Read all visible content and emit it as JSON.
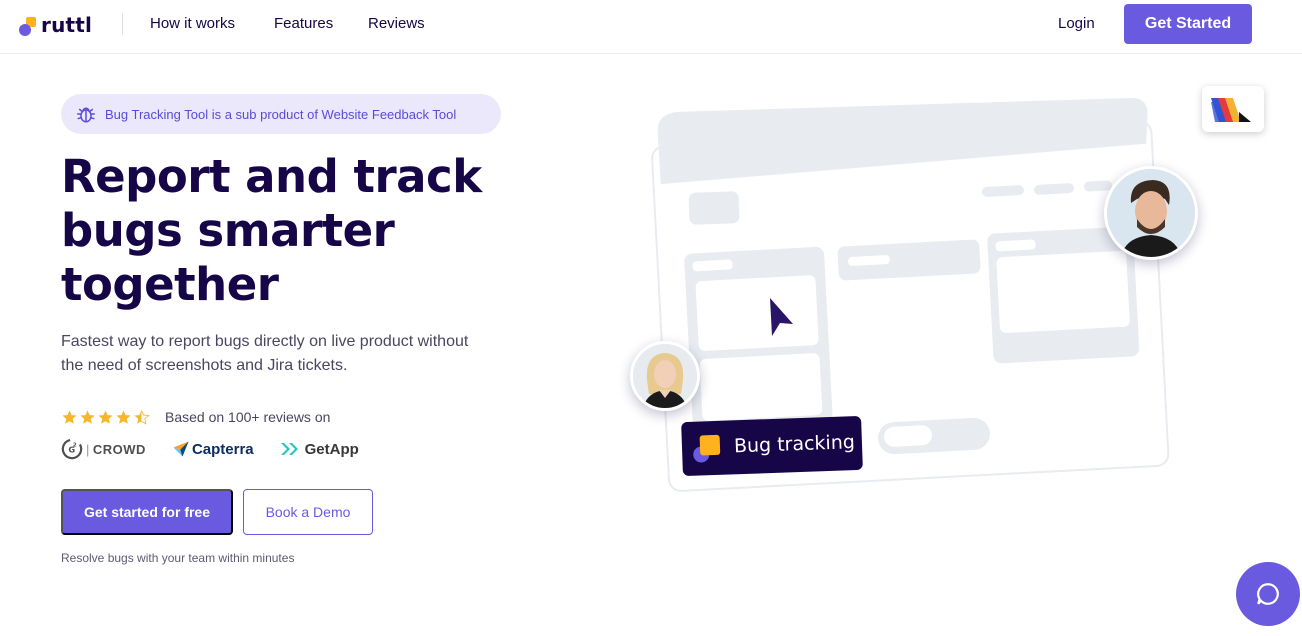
{
  "brand": {
    "name": "ruttl"
  },
  "nav": {
    "links": [
      "How it works",
      "Features",
      "Reviews"
    ],
    "login": "Login",
    "cta": "Get Started"
  },
  "hero": {
    "pill": "Bug Tracking Tool is a sub product of Website Feedback Tool",
    "headline": [
      "Report and track",
      "bugs smarter",
      "together"
    ],
    "subtext": "Fastest way to report bugs directly on live product without the need of screenshots and Jira tickets.",
    "rating": {
      "value": 4.5,
      "max": 5,
      "text": "Based on 100+ reviews on"
    },
    "review_sites": [
      "CROWD",
      "Capterra",
      "GetApp"
    ],
    "primary_cta": "Get started for free",
    "secondary_cta": "Book a Demo",
    "footnote": "Resolve bugs with your team within minutes"
  },
  "illustration": {
    "badge": "Bug tracking"
  },
  "colors": {
    "accent": "#6a5ae0",
    "navy": "#160647",
    "yellow": "#ffb21d",
    "mock": "#e8ebf0",
    "pill_bg": "#ebe8fb"
  },
  "icons": [
    "bug-icon",
    "star-icon",
    "cursor-icon",
    "chat-icon"
  ]
}
